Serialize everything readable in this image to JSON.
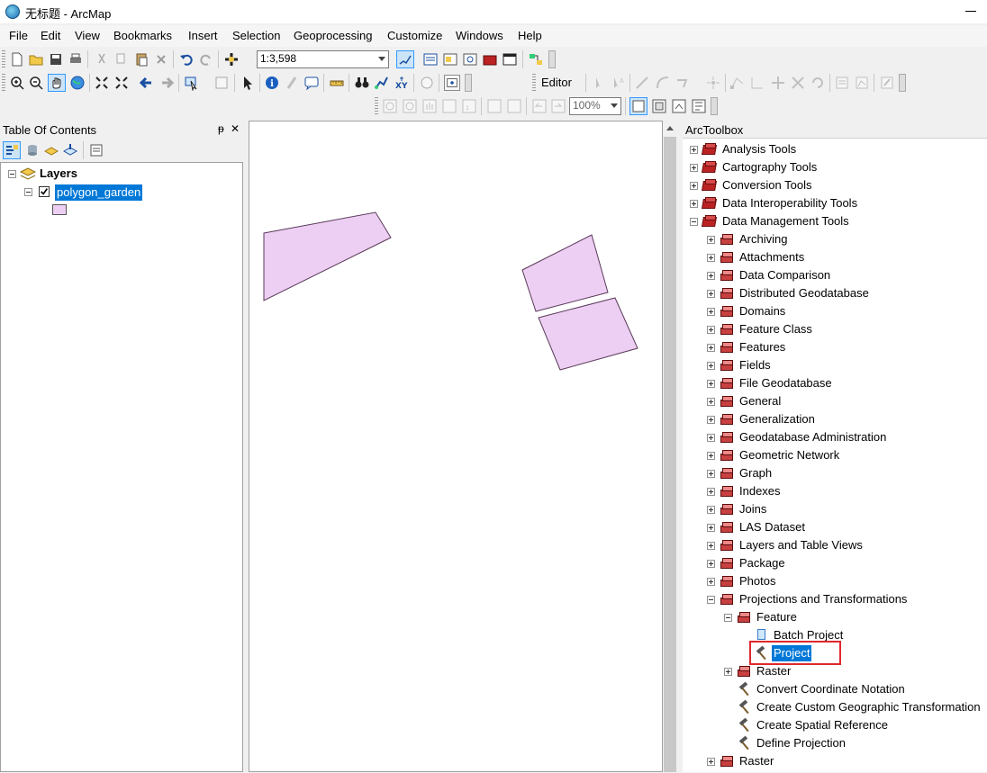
{
  "window": {
    "title": "无标题 - ArcMap"
  },
  "menu": [
    "File",
    "Edit",
    "View",
    "Bookmarks",
    "Insert",
    "Selection",
    "Geoprocessing",
    "Customize",
    "Windows",
    "Help"
  ],
  "toolbar": {
    "scale": "1:3,598",
    "editor_label": "Editor",
    "zoom": "100%"
  },
  "toc": {
    "title": "Table Of Contents",
    "layers_label": "Layers",
    "layer_name": "polygon_garden",
    "pin": "ᵽ",
    "close": "✕",
    "symbol_color": "#eccff2"
  },
  "map": {
    "polygon_fill": "#eccff2",
    "polygon_stroke": "#5a3a5a"
  },
  "toolbox": {
    "title": "ArcToolbox",
    "toolboxes": [
      "Analysis Tools",
      "Cartography Tools",
      "Conversion Tools",
      "Data Interoperability Tools",
      "Data Management Tools"
    ],
    "dm_toolsets": [
      "Archiving",
      "Attachments",
      "Data Comparison",
      "Distributed Geodatabase",
      "Domains",
      "Feature Class",
      "Features",
      "Fields",
      "File Geodatabase",
      "General",
      "Generalization",
      "Geodatabase Administration",
      "Geometric Network",
      "Graph",
      "Indexes",
      "Joins",
      "LAS Dataset",
      "Layers and Table Views",
      "Package",
      "Photos",
      "Projections and Transformations"
    ],
    "pt_feature": "Feature",
    "pt_feature_tools": [
      "Batch Project",
      "Project"
    ],
    "pt_raster": "Raster",
    "pt_tools": [
      "Convert Coordinate Notation",
      "Create Custom Geographic Transformation",
      "Create Spatial Reference",
      "Define Projection"
    ],
    "last_toolset": "Raster",
    "highlight_color": "#e0282d"
  }
}
